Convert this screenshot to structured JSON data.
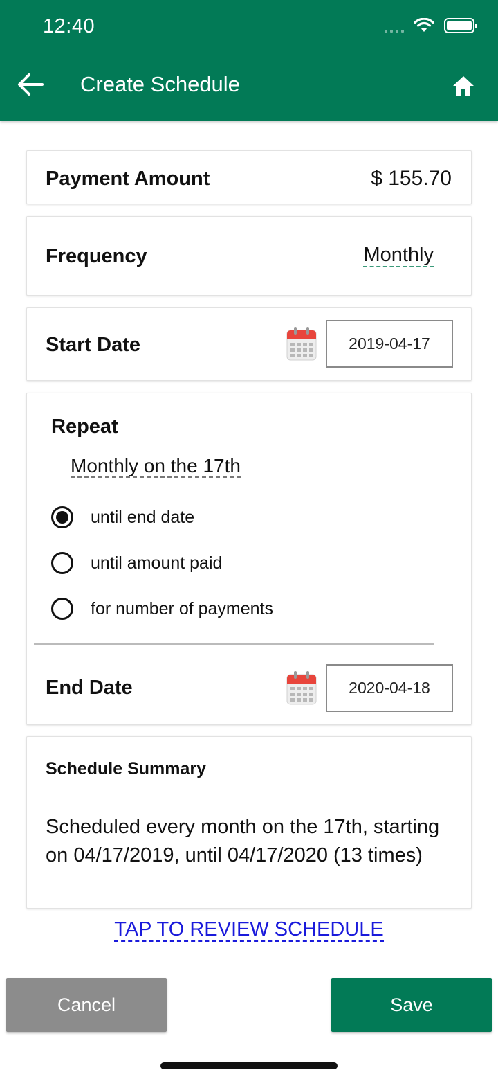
{
  "status_bar": {
    "time": "12:40"
  },
  "header": {
    "title": "Create Schedule"
  },
  "payment_amount": {
    "label": "Payment Amount",
    "value": "$ 155.70"
  },
  "frequency": {
    "label": "Frequency",
    "value": "Monthly"
  },
  "start_date": {
    "label": "Start Date",
    "value": "2019-04-17"
  },
  "repeat": {
    "label": "Repeat",
    "value": "Monthly on the 17th",
    "options": [
      {
        "label": "until end date",
        "selected": true
      },
      {
        "label": "until amount paid",
        "selected": false
      },
      {
        "label": "for number of payments",
        "selected": false
      }
    ]
  },
  "end_date": {
    "label": "End Date",
    "value": "2020-04-18"
  },
  "summary": {
    "title": "Schedule Summary",
    "text": "Scheduled every month on the 17th, starting on 04/17/2019, until 04/17/2020 (13 times)"
  },
  "review_link": "TAP TO REVIEW SCHEDULE",
  "buttons": {
    "cancel": "Cancel",
    "save": "Save"
  },
  "colors": {
    "primary": "#027a56",
    "cancel": "#8c8c8c",
    "link": "#1a1adb"
  }
}
